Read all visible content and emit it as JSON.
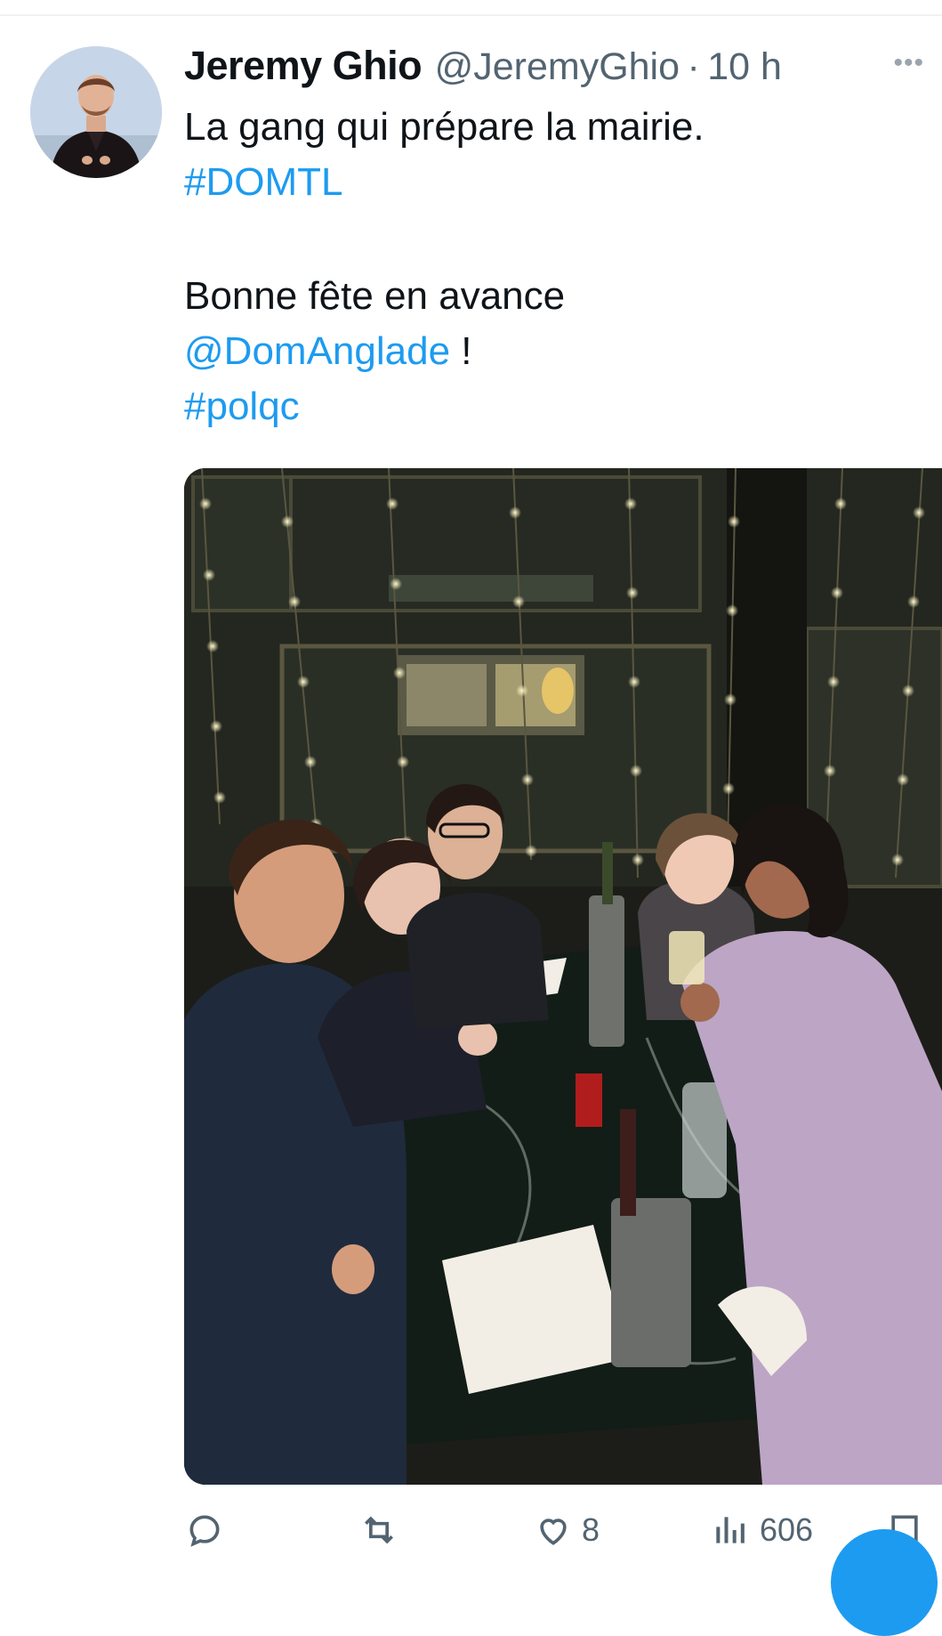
{
  "tweet": {
    "author_name": "Jeremy Ghio",
    "handle": "@JeremyGhio",
    "separator": "·",
    "time_ago": "10 h",
    "more_icon": "more-horizontal-icon",
    "lines": {
      "line1": "La gang qui prépare la mairie.",
      "hashtag1": "#DOMTL",
      "line2": "Bonne fête en avance",
      "mention": "@DomAnglade",
      "mention_suffix": " !",
      "hashtag2": "#polqc"
    },
    "media_description_icon": "group-photo-restaurant"
  },
  "actions": {
    "reply": {
      "icon": "reply-icon",
      "count": ""
    },
    "retweet": {
      "icon": "retweet-icon",
      "count": ""
    },
    "like": {
      "icon": "heart-icon",
      "count": "8"
    },
    "views": {
      "icon": "views-chart-icon",
      "count": "606"
    },
    "share": {
      "icon": "share-icon",
      "count": ""
    }
  },
  "colors": {
    "link": "#1d9bf0",
    "secondary_text": "#536471",
    "primary_text": "#0f1419"
  }
}
